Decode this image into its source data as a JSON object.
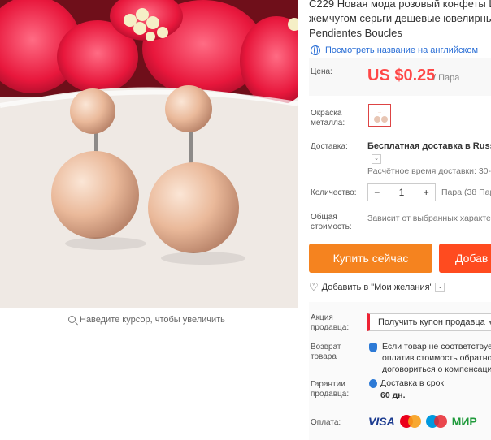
{
  "gallery": {
    "zoom_hint": "Наведите курсор, чтобы увеличить"
  },
  "product": {
    "title_lines": [
      "C229 Новая мода розовый конфеты Ш",
      "жемчугом серьги дешевые ювелирны",
      "Pendientes Boucles"
    ],
    "translate_link": "Посмотреть название на английском"
  },
  "price": {
    "label": "Цена:",
    "value": "US $0.25",
    "unit": "/ Пара"
  },
  "color": {
    "label": "Окраска металла:"
  },
  "shipping": {
    "label": "Доставка:",
    "value": "Бесплатная доставка в Russia",
    "estimate": "Расчётное время доставки: 30-"
  },
  "quantity": {
    "label": "Количество:",
    "minus": "−",
    "value": "1",
    "plus": "+",
    "available": "Пара (38 Пар"
  },
  "total": {
    "label": "Общая стоимость:",
    "value": "Зависит от выбранных характер"
  },
  "actions": {
    "buy_now": "Купить сейчас",
    "add_to_cart": "Добав",
    "wishlist": "Добавить в \"Мои желания\""
  },
  "promo": {
    "label": "Акция продавца:",
    "coupon": "Получить купон продавца"
  },
  "refund": {
    "label": "Возврат товара",
    "line1": "Если товар не соответствует",
    "line2": "оплатив стоимость обратно",
    "line3": "договориться о компенсаци"
  },
  "guarantee": {
    "label": "Гарантии продавца:",
    "line1": "Доставка в срок",
    "line2": "60 дн."
  },
  "payment": {
    "label": "Оплата:",
    "methods": [
      "VISA",
      "MasterCard",
      "Maestro",
      "МИР"
    ]
  },
  "colors": {
    "price": "#ff4747",
    "buy": "#f5831f",
    "cart": "#ff4b1f",
    "link": "#2b6fd6"
  }
}
